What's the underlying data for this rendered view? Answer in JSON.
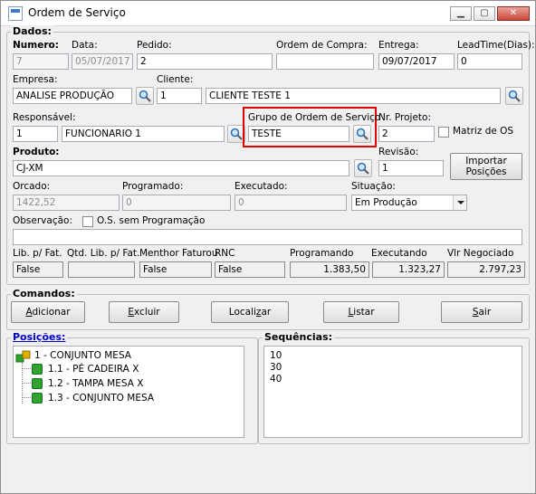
{
  "window": {
    "title": "Ordem de Serviço",
    "minimize": "▁",
    "maximize": "▢",
    "close": "✕"
  },
  "dados": {
    "group_title": "Dados:",
    "numero": {
      "label": "Numero:",
      "value": "7"
    },
    "data": {
      "label": "Data:",
      "value": "05/07/2017"
    },
    "pedido": {
      "label": "Pedido:",
      "value": "2"
    },
    "ordem_compra": {
      "label": "Ordem de Compra:",
      "value": ""
    },
    "entrega": {
      "label": "Entrega:",
      "value": "09/07/2017"
    },
    "leadtime": {
      "label": "LeadTime(Dias):",
      "value": "0"
    },
    "empresa": {
      "label": "Empresa:",
      "value": "ANALISE PRODUÇÃO"
    },
    "cliente": {
      "label": "Cliente:",
      "code": "1",
      "name": "CLIENTE TESTE 1"
    },
    "responsavel": {
      "label": "Responsável:",
      "code": "1",
      "name": "FUNCIONARIO 1"
    },
    "grupo_os": {
      "label": "Grupo de Ordem de Serviço",
      "value": "TESTE"
    },
    "nr_projeto": {
      "label": "Nr. Projeto:",
      "value": "2"
    },
    "matriz_os": {
      "label": "Matriz de OS"
    },
    "produto": {
      "label": "Produto:",
      "value": "CJ-XM"
    },
    "revisao": {
      "label": "Revisão:",
      "value": "1"
    },
    "importar": {
      "label_line1": "Importar",
      "label_line2": "Posições"
    },
    "orcado": {
      "label": "Orcado:",
      "value": "1422,52"
    },
    "programado": {
      "label": "Programado:",
      "value": "0"
    },
    "executado": {
      "label": "Executado:",
      "value": "0"
    },
    "situacao": {
      "label": "Situação:",
      "value": "Em Produção"
    },
    "observacao": {
      "label": "Observação:",
      "value": ""
    },
    "os_sem_prog": {
      "label": "O.S.  sem Programação"
    },
    "summary": {
      "lib_fat": {
        "label": "Lib. p/ Fat.",
        "value": "False"
      },
      "qtd_lib_fat": {
        "label": "Qtd. Lib. p/ Fat.",
        "value": ""
      },
      "menthor_faturou": {
        "label": "Menthor Faturou",
        "value": "False"
      },
      "rnc": {
        "label": "RNC",
        "value": "False"
      },
      "programando": {
        "label": "Programando",
        "value": "1.383,50"
      },
      "executando": {
        "label": "Executando",
        "value": "1.323,27"
      },
      "vlr_negociado": {
        "label": "Vlr Negociado",
        "value": "2.797,23"
      }
    }
  },
  "comandos": {
    "group_title": "Comandos:",
    "adicionar": {
      "u": "A",
      "rest": "dicionar"
    },
    "excluir": {
      "u": "E",
      "rest": "xcluir"
    },
    "localizar": {
      "pre": "Locali",
      "u": "z",
      "rest": "ar"
    },
    "listar": {
      "u": "L",
      "rest": "istar"
    },
    "sair": {
      "u": "S",
      "rest": "air"
    }
  },
  "posicoes": {
    "title": "Posições:",
    "root": "1 - CONJUNTO MESA",
    "children": [
      "1.1 - PÉ CADEIRA X",
      "1.2 - TAMPA MESA X",
      "1.3 - CONJUNTO MESA"
    ]
  },
  "sequencias": {
    "title": "Sequências:",
    "items": [
      "10",
      "30",
      "40"
    ]
  }
}
